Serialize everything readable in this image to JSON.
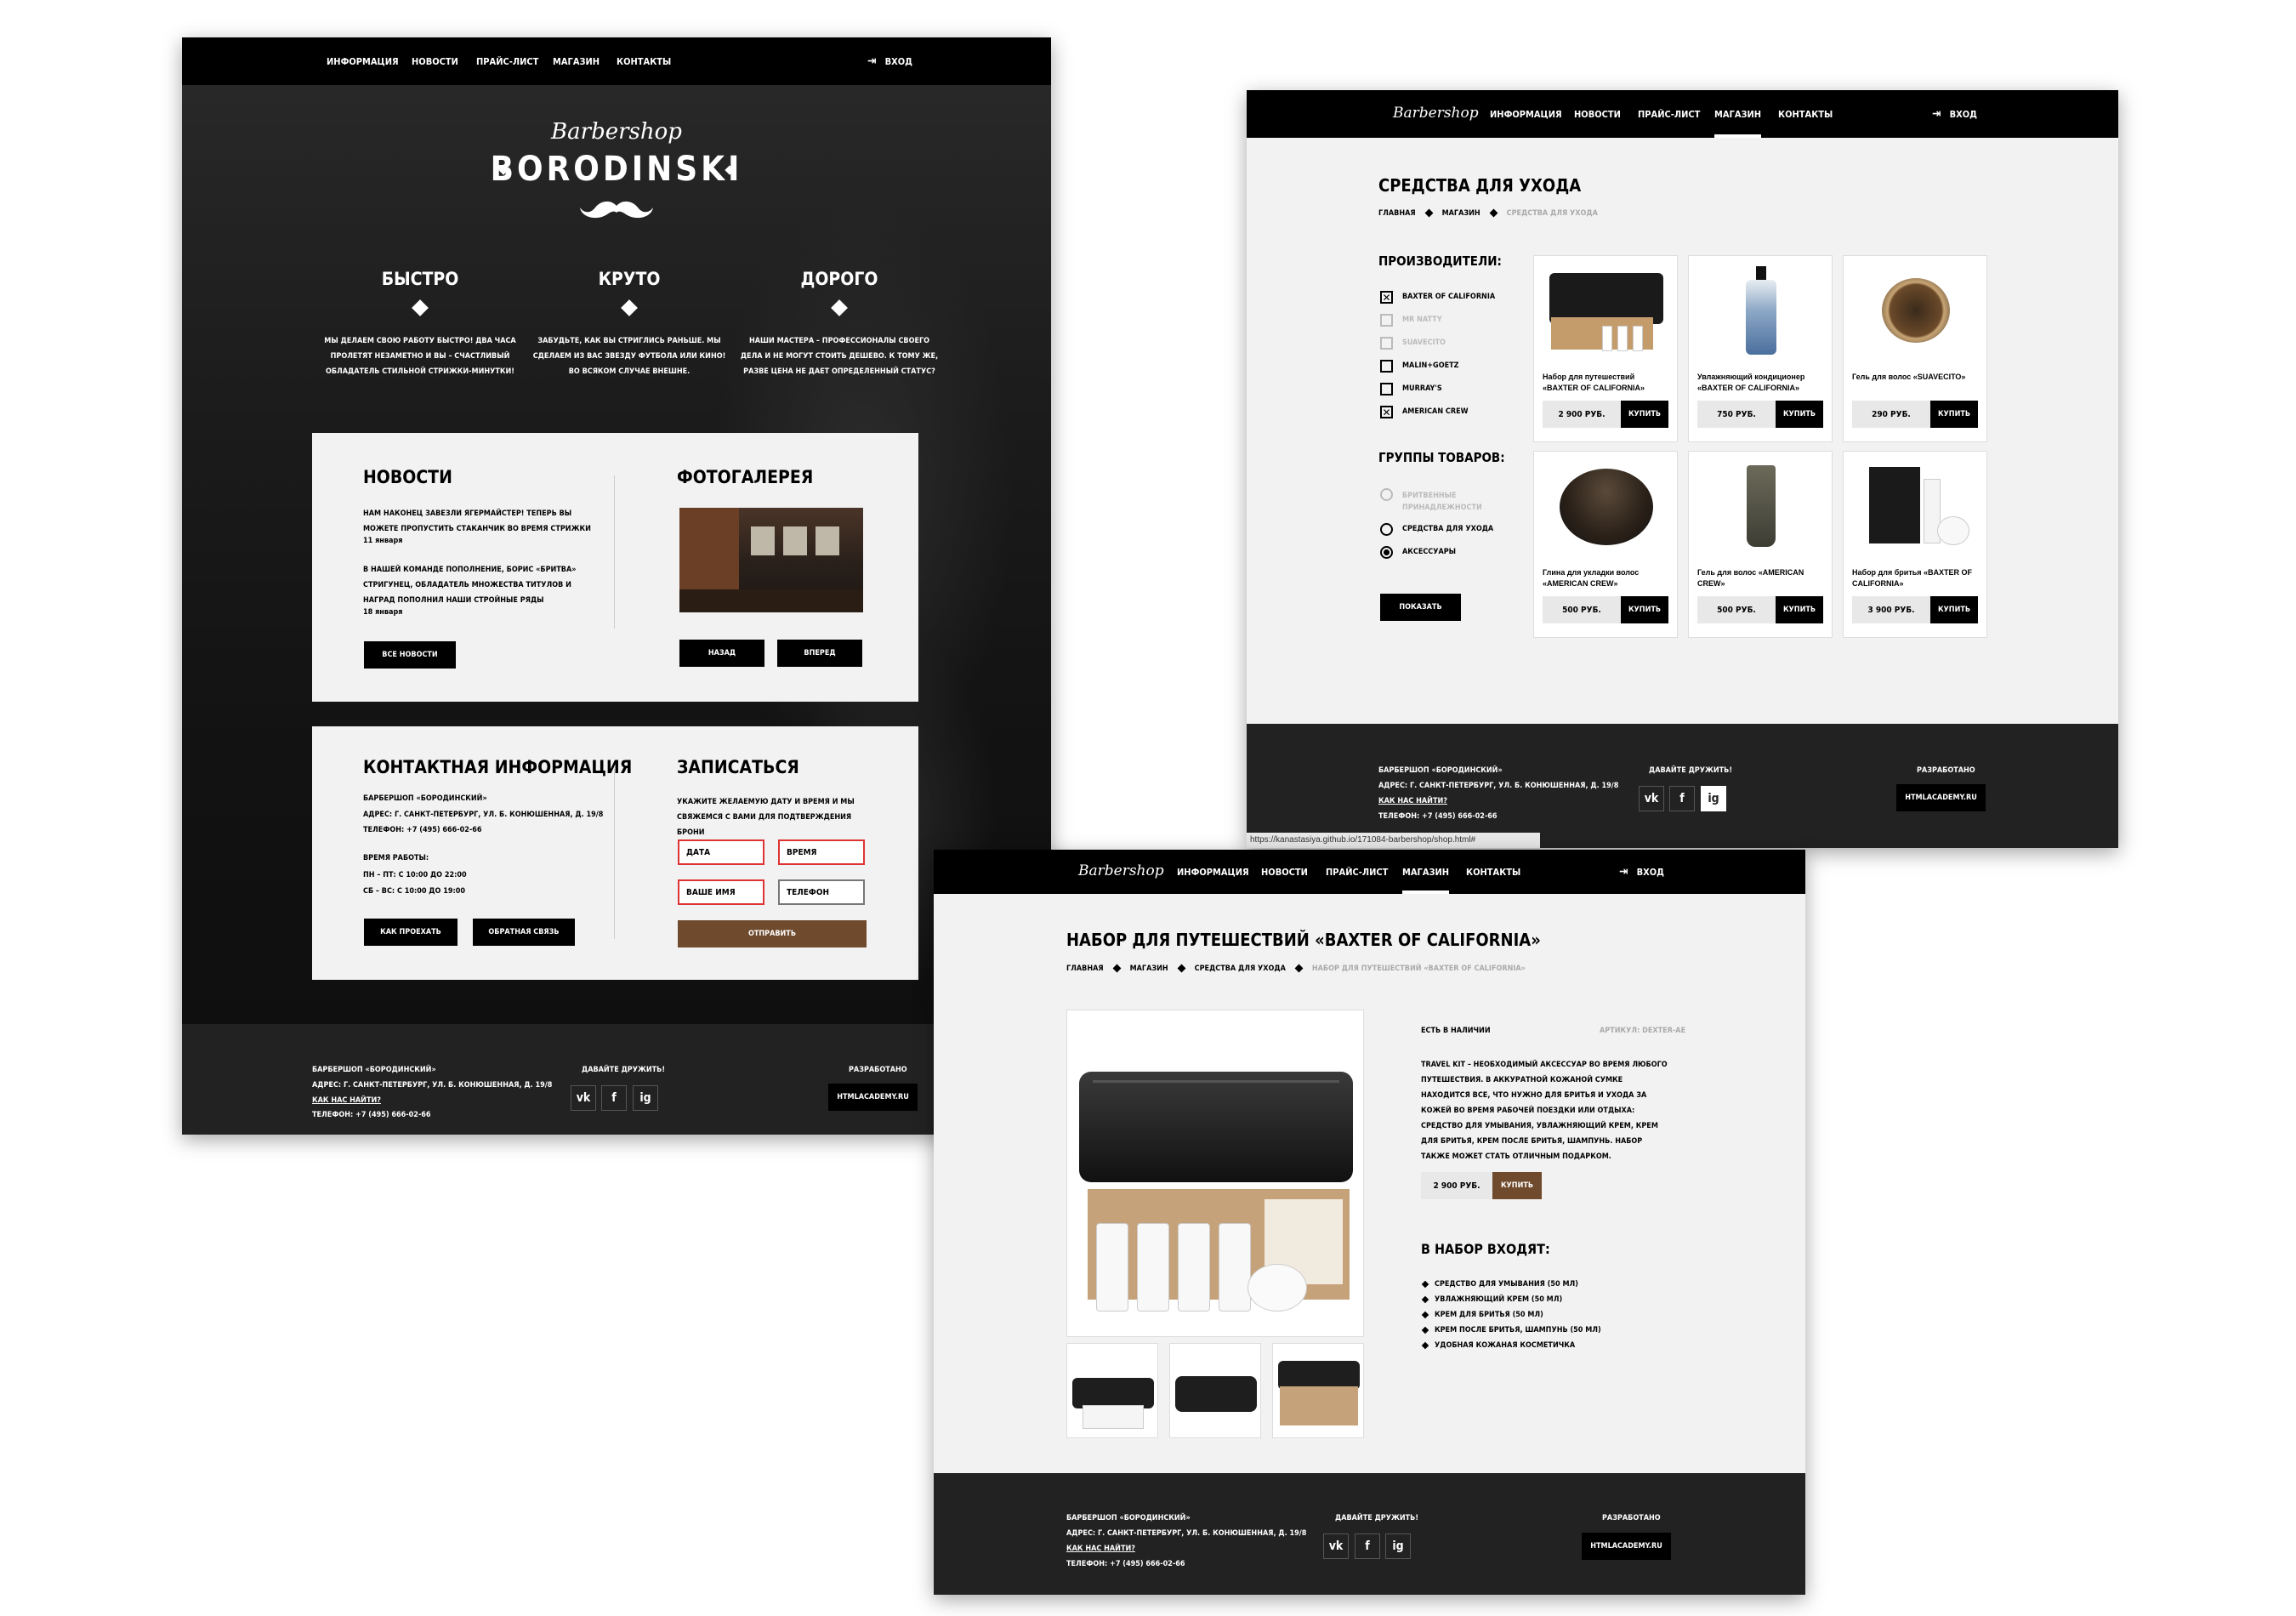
{
  "home": {
    "nav": [
      "ИНФОРМАЦИЯ",
      "НОВОСТИ",
      "ПРАЙС-ЛИСТ",
      "МАГАЗИН",
      "КОНТАКТЫ"
    ],
    "login": "ВХОД",
    "logo_script": "Barbershop",
    "logo_main": "BORODINSKI",
    "features": [
      {
        "title": "БЫСТРО",
        "text": "МЫ ДЕЛАЕМ СВОЮ РАБОТУ БЫСТРО! ДВА ЧАСА ПРОЛЕТЯТ НЕЗАМЕТНО И ВЫ – СЧАСТЛИВЫЙ ОБЛАДАТЕЛЬ СТИЛЬНОЙ СТРИЖКИ-МИНУТКИ!"
      },
      {
        "title": "КРУТО",
        "text": "ЗАБУДЬТЕ, КАК ВЫ СТРИГЛИСЬ РАНЬШЕ. МЫ СДЕЛАЕМ ИЗ ВАС ЗВЕЗДУ ФУТБОЛА ИЛИ КИНО! ВО ВСЯКОМ СЛУЧАЕ ВНЕШНЕ."
      },
      {
        "title": "ДОРОГО",
        "text": "НАШИ МАСТЕРА – ПРОФЕССИОНАЛЫ СВОЕГО ДЕЛА И НЕ МОГУТ СТОИТЬ ДЕШЕВО. К ТОМУ ЖЕ, РАЗВЕ ЦЕНА НЕ ДАЕТ ОПРЕДЕЛЕННЫЙ СТАТУС?"
      }
    ],
    "news": {
      "title": "НОВОСТИ",
      "items": [
        {
          "text": "НАМ НАКОНЕЦ ЗАВЕЗЛИ ЯГЕРМАЙСТЕР! ТЕПЕРЬ ВЫ МОЖЕТЕ ПРОПУСТИТЬ СТАКАНЧИК ВО ВРЕМЯ СТРИЖКИ",
          "date": "11 января"
        },
        {
          "text": "В НАШЕЙ КОМАНДЕ ПОПОЛНЕНИЕ, БОРИС «БРИТВА» СТРИГУНЕЦ, ОБЛАДАТЕЛЬ МНОЖЕСТВА ТИТУЛОВ И НАГРАД ПОПОЛНИЛ НАШИ СТРОЙНЫЕ РЯДЫ",
          "date": "18 января"
        }
      ],
      "all_button": "ВСЕ НОВОСТИ"
    },
    "gallery": {
      "title": "ФОТОГАЛЕРЕЯ",
      "prev": "НАЗАД",
      "next": "ВПЕРЕД"
    },
    "contacts": {
      "title": "КОНТАКТНАЯ ИНФОРМАЦИЯ",
      "name": "БАРБЕРШОП «БОРОДИНСКИЙ»",
      "address": "АДРЕС: Г. САНКТ-ПЕТЕРБУРГ, УЛ. Б. КОНЮШЕННАЯ, Д. 19/8",
      "phone": "ТЕЛЕФОН: +7 (495) 666-02-66",
      "hours_title": "ВРЕМЯ РАБОТЫ:",
      "hours_1": "ПН – ПТ: С 10:00 ДО 22:00",
      "hours_2": "СБ – ВС: С 10:00 ДО 19:00",
      "route_button": "КАК ПРОЕХАТЬ",
      "feedback_button": "ОБРАТНАЯ СВЯЗЬ"
    },
    "booking": {
      "title": "ЗАПИСАТЬСЯ",
      "text": "УКАЖИТЕ ЖЕЛАЕМУЮ ДАТУ И ВРЕМЯ И МЫ СВЯЖЕМСЯ С ВАМИ ДЛЯ ПОДТВЕРЖДЕНИЯ БРОНИ",
      "date": "ДАТА",
      "time": "ВРЕМЯ",
      "name": "ВАШЕ ИМЯ",
      "phone": "ТЕЛЕФОН",
      "submit": "ОТПРАВИТЬ"
    }
  },
  "footer": {
    "name": "БАРБЕРШОП «БОРОДИНСКИЙ»",
    "address": "АДРЕС: Г. САНКТ-ПЕТЕРБУРГ, УЛ. Б. КОНЮШЕННАЯ, Д. 19/8",
    "route": "КАК НАС НАЙТИ?",
    "phone": "ТЕЛЕФОН: +7 (495) 666-02-66",
    "social_title": "ДАВАЙТЕ ДРУЖИТЬ!",
    "social": [
      "vk",
      "f",
      "ig"
    ],
    "dev_title": "РАЗРАБОТАНО",
    "dev": "HTMLACADEMY.RU"
  },
  "shop": {
    "logo_script": "Barbershop",
    "nav": [
      "ИНФОРМАЦИЯ",
      "НОВОСТИ",
      "ПРАЙС-ЛИСТ",
      "МАГАЗИН",
      "КОНТАКТЫ"
    ],
    "login": "ВХОД",
    "title": "СРЕДСТВА ДЛЯ УХОДА",
    "breadcrumbs": [
      "ГЛАВНАЯ",
      "МАГАЗИН",
      "СРЕДСТВА ДЛЯ УХОДА"
    ],
    "makers_title": "ПРОИЗВОДИТЕЛИ:",
    "makers": [
      {
        "label": "BAXTER OF CALIFORNIA",
        "state": "checked"
      },
      {
        "label": "MR NATTY",
        "state": "disabled"
      },
      {
        "label": "SUAVECITO",
        "state": "disabled"
      },
      {
        "label": "MALIN+GOETZ",
        "state": "unchecked"
      },
      {
        "label": "MURRAY'S",
        "state": "unchecked"
      },
      {
        "label": "AMERICAN CREW",
        "state": "checked"
      }
    ],
    "groups_title": "ГРУППЫ ТОВАРОВ:",
    "groups": [
      {
        "label": "БРИТВЕННЫЕ ПРИНАДЛЕЖНОСТИ",
        "state": "disabled"
      },
      {
        "label": "СРЕДСТВА ДЛЯ УХОДА",
        "state": "unchecked"
      },
      {
        "label": "АКСЕССУАРЫ",
        "state": "checked"
      }
    ],
    "show_button": "ПОКАЗАТЬ",
    "buy": "КУПИТЬ",
    "products": [
      {
        "name": "Набор для путешествий «BAXTER OF CALIFORNIA»",
        "price": "2 900 РУБ.",
        "img": "bag"
      },
      {
        "name": "Увлажняющий кондиционер «BAXTER OF CALIFORNIA»",
        "price": "750 РУБ.",
        "img": "bottle"
      },
      {
        "name": "Гель для волос «SUAVECITO»",
        "price": "290 РУБ.",
        "img": "jar"
      },
      {
        "name": "Глина для укладки волос «AMERICAN CREW»",
        "price": "500 РУБ.",
        "img": "clay"
      },
      {
        "name": "Гель для волос «AMERICAN CREW»",
        "price": "500 РУБ.",
        "img": "tube"
      },
      {
        "name": "Набор для бритья «BAXTER OF CALIFORNIA»",
        "price": "3 900 РУБ.",
        "img": "kit"
      }
    ],
    "status_url": "https://kanastasiya.github.io/171084-barbershop/shop.html#"
  },
  "product": {
    "logo_script": "Barbershop",
    "nav": [
      "ИНФОРМАЦИЯ",
      "НОВОСТИ",
      "ПРАЙС-ЛИСТ",
      "МАГАЗИН",
      "КОНТАКТЫ"
    ],
    "login": "ВХОД",
    "title": "НАБОР ДЛЯ ПУТЕШЕСТВИЙ «BAXTER OF CALIFORNIA»",
    "breadcrumbs": [
      "ГЛАВНАЯ",
      "МАГАЗИН",
      "СРЕДСТВА ДЛЯ УХОДА",
      "НАБОР ДЛЯ ПУТЕШЕСТВИЙ «BAXTER OF CALIFORNIA»"
    ],
    "availability": "ЕСТЬ В НАЛИЧИИ",
    "sku": "АРТИКУЛ: DEXTER-AE",
    "description": "TRAVEL KIT – НЕОБХОДИМЫЙ АКСЕССУАР ВО ВРЕМЯ ЛЮБОГО ПУТЕШЕСТВИЯ. В АККУРАТНОЙ КОЖАНОЙ СУМКЕ НАХОДИТСЯ ВСЕ, ЧТО НУЖНО ДЛЯ БРИТЬЯ И УХОДА ЗА КОЖЕЙ ВО ВРЕМЯ РАБОЧЕЙ ПОЕЗДКИ ИЛИ ОТДЫХА: СРЕДСТВО ДЛЯ УМЫВАНИЯ, УВЛАЖНЯЮЩИЙ КРЕМ, КРЕМ ДЛЯ БРИТЬЯ, КРЕМ ПОСЛЕ БРИТЬЯ, ШАМПУНЬ. НАБОР ТАКЖЕ МОЖЕТ СТАТЬ ОТЛИЧНЫМ ПОДАРКОМ.",
    "price": "2 900 РУБ.",
    "buy": "КУПИТЬ",
    "includes_title": "В НАБОР ВХОДЯТ:",
    "includes": [
      "СРЕДСТВО ДЛЯ УМЫВАНИЯ (50 МЛ)",
      "УВЛАЖНЯЮЩИЙ КРЕМ (50 МЛ)",
      "КРЕМ ДЛЯ БРИТЬЯ (50 МЛ)",
      "КРЕМ ПОСЛЕ БРИТЬЯ, ШАМПУНЬ (50 МЛ)",
      "УДОБНАЯ КОЖАНАЯ КОСМЕТИЧКА"
    ]
  }
}
